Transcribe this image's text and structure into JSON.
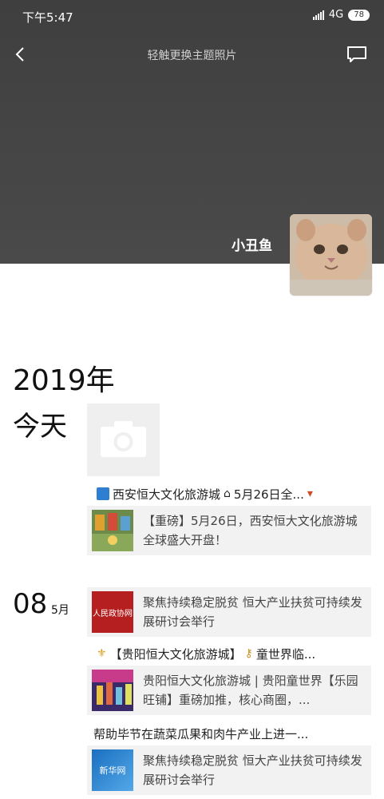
{
  "status": {
    "time": "下午5:47",
    "network": "4G",
    "battery": "78"
  },
  "nav": {
    "title": "轻触更换主题照片"
  },
  "profile": {
    "name": "小丑鱼"
  },
  "timeline": {
    "year": "2019年",
    "today_label": "今天",
    "date_day": "08",
    "date_month": "5月",
    "cards": [
      {
        "header_a": "西安恒大文化旅游城",
        "header_b": "5月26日全...",
        "body": "【重磅】5月26日，西安恒大文化旅游城全球盛大开盘！"
      },
      {
        "body": "聚焦持续稳定脱贫 恒大产业扶贫可持续发展研讨会举行",
        "thumb_text": "人民政协网"
      },
      {
        "header_a": "【贵阳恒大文化旅游城】",
        "header_b": "童世界临...",
        "body": "贵阳恒大文化旅游城 | 贵阳童世界【乐园旺铺】重磅加推，核心商圈，..."
      },
      {
        "header_a": "帮助毕节在蔬菜瓜果和肉牛产业上进一...",
        "body": "聚焦持续稳定脱贫 恒大产业扶贫可持续发展研讨会举行",
        "thumb_text": "新华网"
      }
    ]
  }
}
